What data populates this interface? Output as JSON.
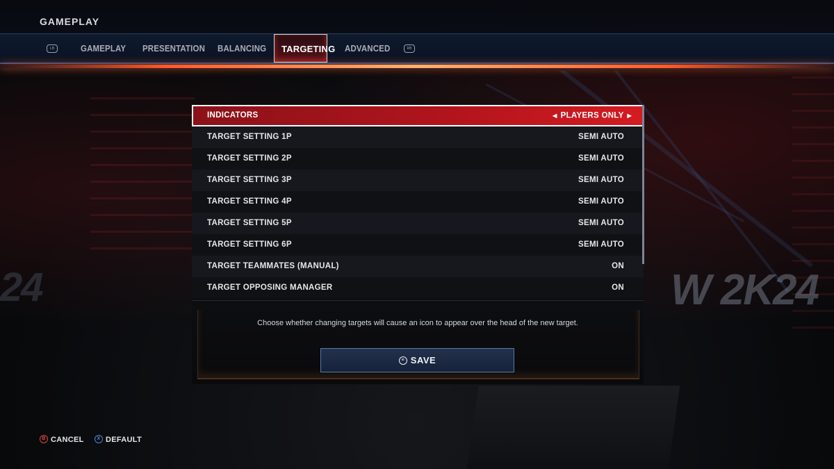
{
  "header": {
    "title": "GAMEPLAY",
    "left_bumper": "LB",
    "right_bumper": "RB",
    "tabs": [
      {
        "label": "GAMEPLAY"
      },
      {
        "label": "PRESENTATION"
      },
      {
        "label": "BALANCING"
      },
      {
        "label": "TARGETING"
      },
      {
        "label": "ADVANCED"
      }
    ],
    "active_tab": "TARGETING"
  },
  "settings": [
    {
      "label": "INDICATORS",
      "value": "PLAYERS ONLY",
      "selected": true
    },
    {
      "label": "TARGET SETTING 1P",
      "value": "SEMI AUTO"
    },
    {
      "label": "TARGET SETTING 2P",
      "value": "SEMI AUTO"
    },
    {
      "label": "TARGET SETTING 3P",
      "value": "SEMI AUTO"
    },
    {
      "label": "TARGET SETTING 4P",
      "value": "SEMI AUTO"
    },
    {
      "label": "TARGET SETTING 5P",
      "value": "SEMI AUTO"
    },
    {
      "label": "TARGET SETTING 6P",
      "value": "SEMI AUTO"
    },
    {
      "label": "TARGET TEAMMATES (MANUAL)",
      "value": "ON"
    },
    {
      "label": "TARGET OPPOSING MANAGER",
      "value": "ON"
    }
  ],
  "description": "Choose whether changing targets will cause an icon to appear over the head of the new target.",
  "save_label": "SAVE",
  "footer": {
    "cancel_label": "CANCEL",
    "default_label": "DEFAULT"
  },
  "background": {
    "logo_left": "24",
    "logo_right": "W 2K24"
  },
  "colors": {
    "accent_red": "#b0141c",
    "tab_glow": "#ff5a2a",
    "save_border": "#5879a8"
  },
  "icons": {
    "cancel": "circle-b-icon",
    "default": "circle-x-icon",
    "save": "menu-button-icon",
    "option_prev": "triangle-left-icon",
    "option_next": "triangle-right-icon"
  }
}
